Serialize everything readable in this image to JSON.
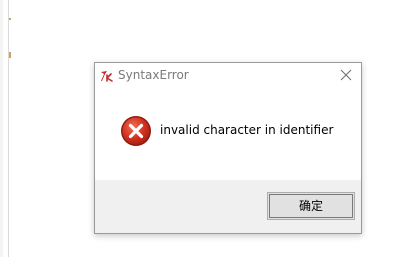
{
  "dialog": {
    "title": "SyntaxError",
    "message": "invalid character in identifier",
    "ok_label": "确定"
  },
  "icons": {
    "title": "tk-feather-icon",
    "close": "close-icon",
    "error": "error-icon"
  },
  "colors": {
    "error_red": "#c42b1c",
    "footer_bg": "#f0f0f0",
    "button_bg": "#e1e1e1"
  }
}
